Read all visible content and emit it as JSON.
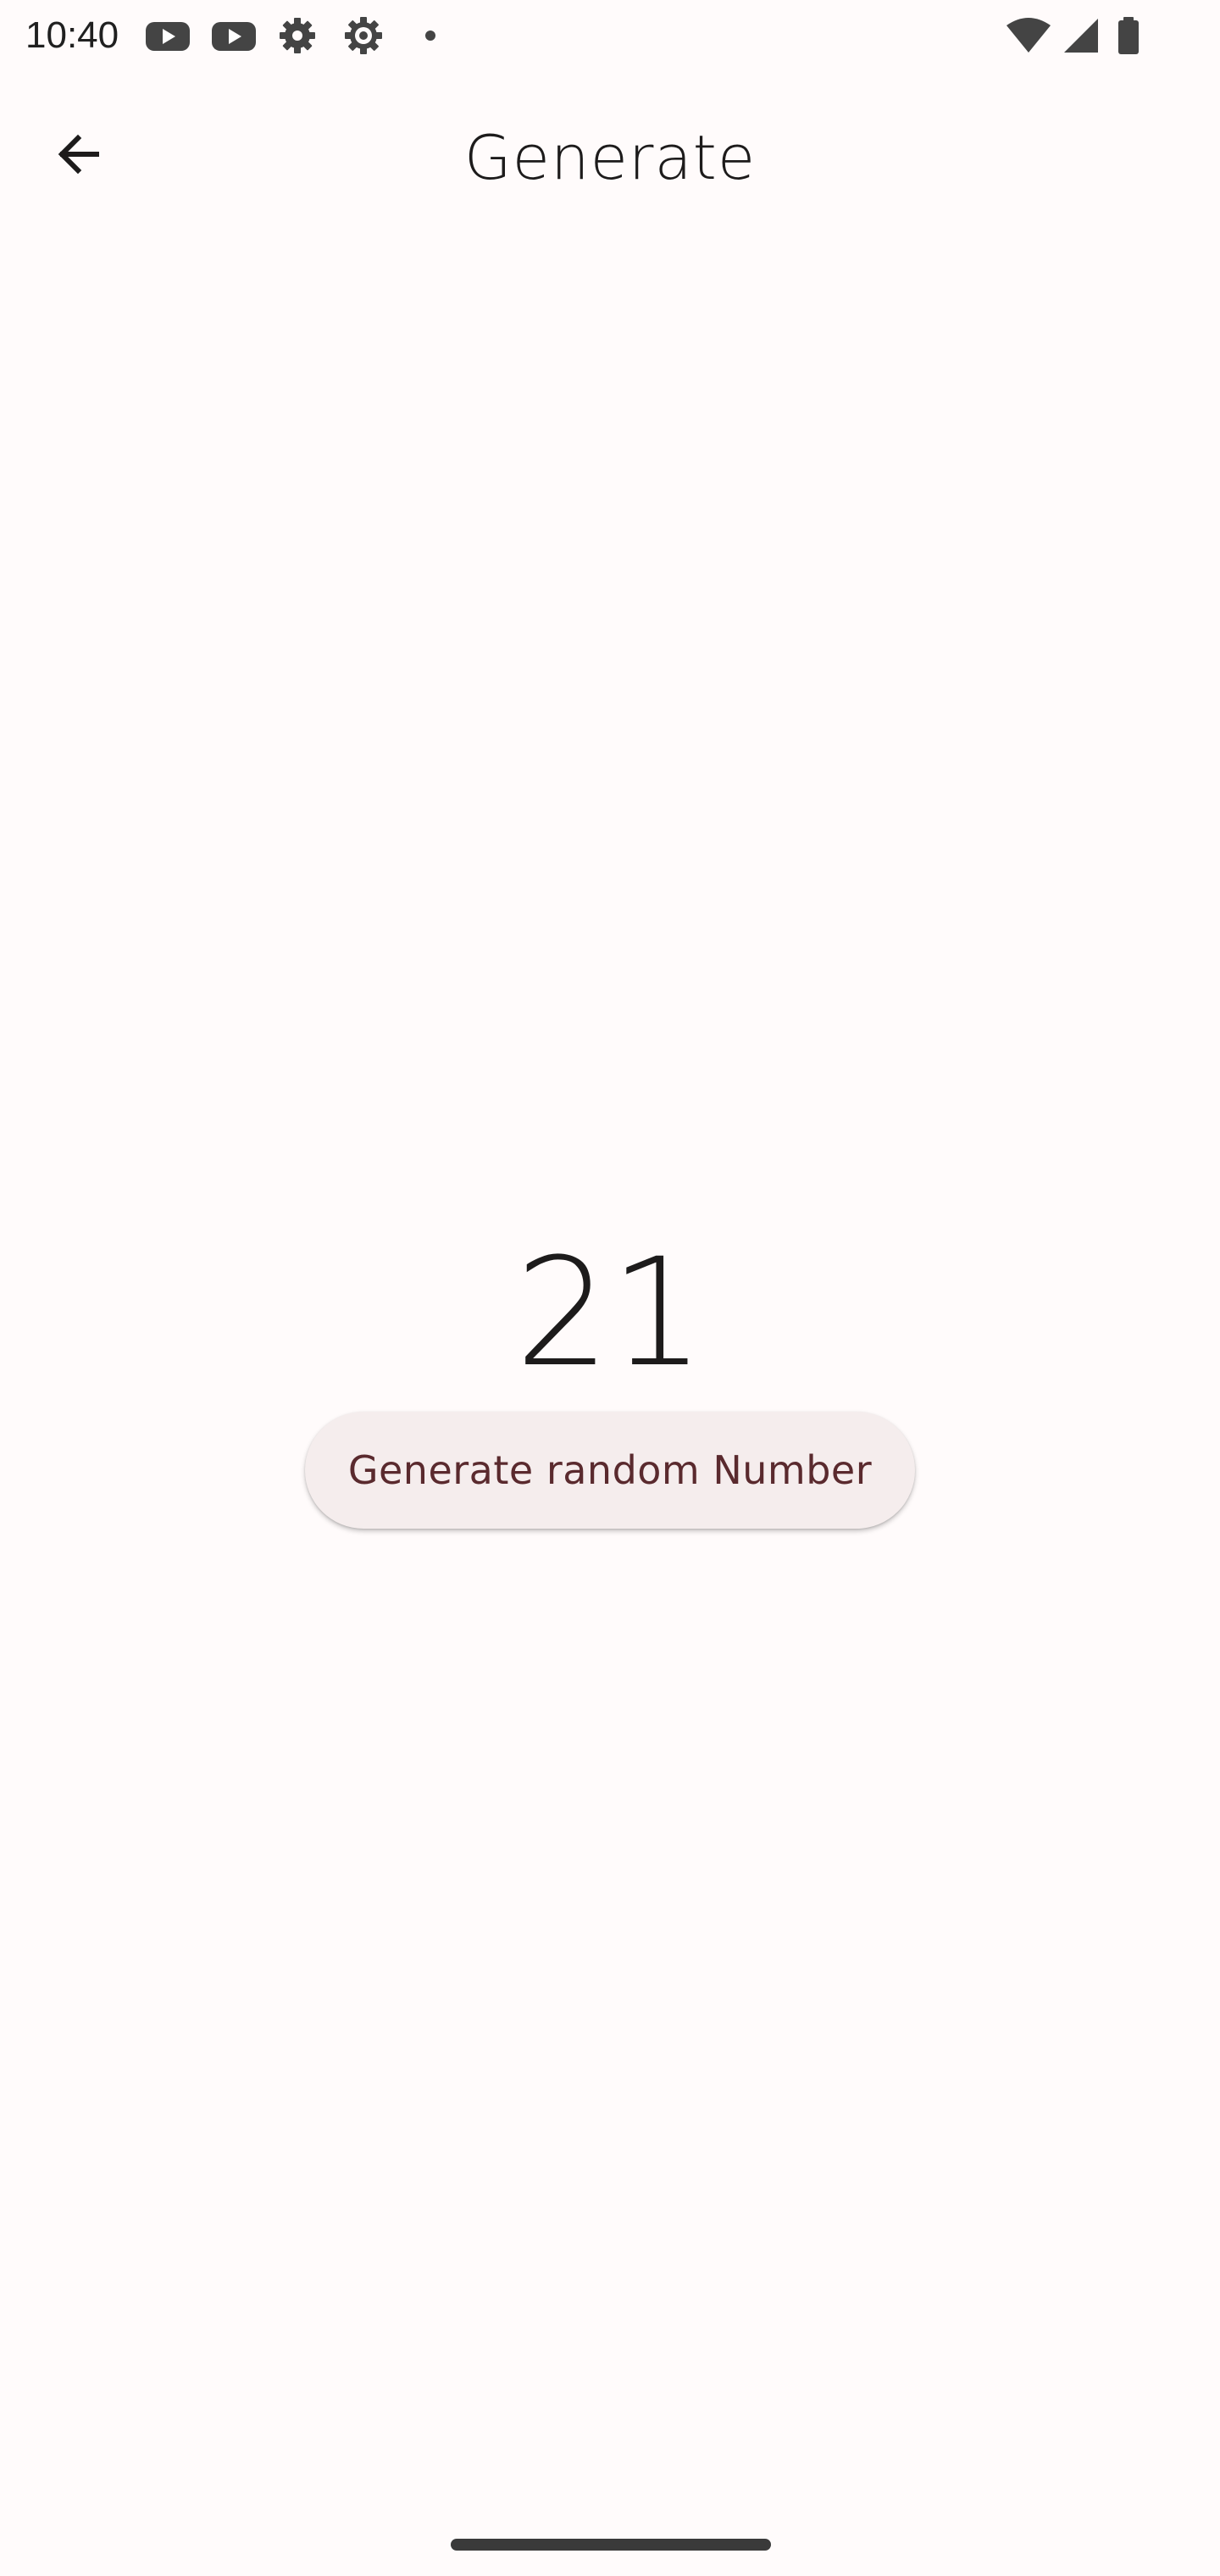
{
  "status_bar": {
    "time": "10:40",
    "icons": [
      "youtube-icon",
      "youtube-icon",
      "settings-icon",
      "settings-icon",
      "dot-icon",
      "wifi-icon",
      "signal-icon",
      "battery-icon"
    ]
  },
  "app_bar": {
    "title": "Generate",
    "back_icon": "arrow-back-icon"
  },
  "main": {
    "number": "21",
    "generate_button_label": "Generate random Number"
  },
  "colors": {
    "background": "#fffbfb",
    "button_background": "#f5eded",
    "button_text": "#5a2a2e",
    "text": "#1d1b1b"
  }
}
